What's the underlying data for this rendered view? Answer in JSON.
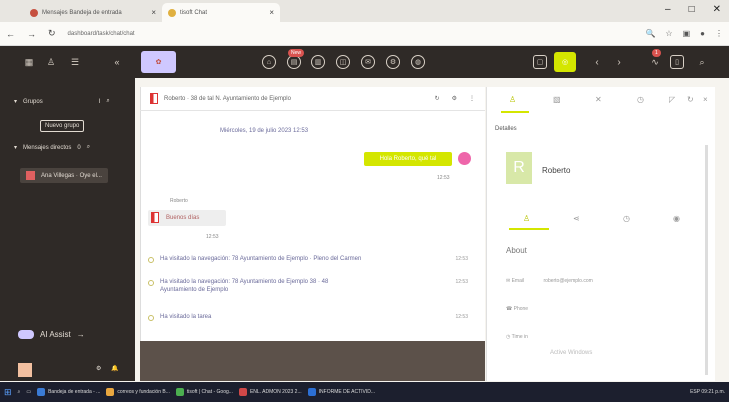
{
  "browser": {
    "tabs": [
      {
        "label": "Mensajes Bandeja de entrada"
      },
      {
        "label": "tisoft Chat"
      }
    ],
    "url": "dashboard/task/chat/chat",
    "window_controls": [
      "–",
      "□",
      "✕"
    ]
  },
  "toolbar": {
    "badge1": "New",
    "badge2": "1"
  },
  "sidebar": {
    "groups_label": "Grupos",
    "new_group_button": "Nuevo grupo",
    "dm_label": "Mensajes directos",
    "dm_count": "0",
    "contact": "Ana Villegas · Oye el...",
    "ai_assist": "AI Assist"
  },
  "chat": {
    "header": "Roberto · 38 de tal N. Ayuntamiento de Ejemplo",
    "date_separator": "Miércoles, 19 de julio 2023 12:53",
    "my_message": "Hola Roberto, qué tal",
    "my_time": "12:53",
    "sender": "Roberto",
    "in_message": "Buenos días",
    "in_time": "12:53",
    "history": [
      {
        "text": "Ha visitado la navegación: 78 Ayuntamiento de Ejemplo · Pleno del Carmen",
        "time": "12:53"
      },
      {
        "text": "Ha visitado la navegación: 78 Ayuntamiento de Ejemplo 38 · 48",
        "text2": "Ayuntamiento de Ejemplo",
        "time": "12:53"
      },
      {
        "text": "Ha visitado la tarea",
        "time": "12:53"
      }
    ]
  },
  "rpanel": {
    "details": "Detalles",
    "name": "Roberto",
    "avatar_letter": "R",
    "about": "About",
    "email_label": "Email",
    "email": "roberto@ejemplo.com",
    "phone_label": "Phone",
    "time_label": "Time in",
    "locale": "Active Windows"
  },
  "taskbar": {
    "items": [
      "Bandeja de entrada - ...",
      "correos y fundación B...",
      "tisoft | Chat - Goog...",
      "ENL. ADMON 2023 2...",
      "INFORME DE ACTIVID..."
    ],
    "tray": "ESP  09:21 p.m."
  }
}
